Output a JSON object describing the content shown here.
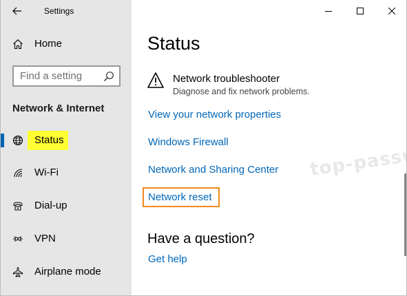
{
  "window": {
    "title": "Settings"
  },
  "sidebar": {
    "home_label": "Home",
    "search_placeholder": "Find a setting",
    "section_title": "Network & Internet",
    "items": [
      {
        "label": "Status",
        "icon": "globe-icon",
        "active": true
      },
      {
        "label": "Wi-Fi",
        "icon": "wifi-icon"
      },
      {
        "label": "Dial-up",
        "icon": "dialup-icon"
      },
      {
        "label": "VPN",
        "icon": "vpn-icon"
      },
      {
        "label": "Airplane mode",
        "icon": "airplane-icon"
      }
    ]
  },
  "main": {
    "title": "Status",
    "troubleshooter": {
      "title": "Network troubleshooter",
      "description": "Diagnose and fix network problems."
    },
    "links": {
      "view_properties": "View your network properties",
      "firewall": "Windows Firewall",
      "sharing_center": "Network and Sharing Center",
      "network_reset": "Network reset"
    },
    "question": {
      "title": "Have a question?",
      "help_link": "Get help"
    }
  },
  "watermark": "top-password.com",
  "colors": {
    "sidebar_bg": "#e6e6e6",
    "link": "#0067b8",
    "accent": "#0063b1",
    "highlight": "#ffff33",
    "callout_outline": "#f08a1c"
  }
}
